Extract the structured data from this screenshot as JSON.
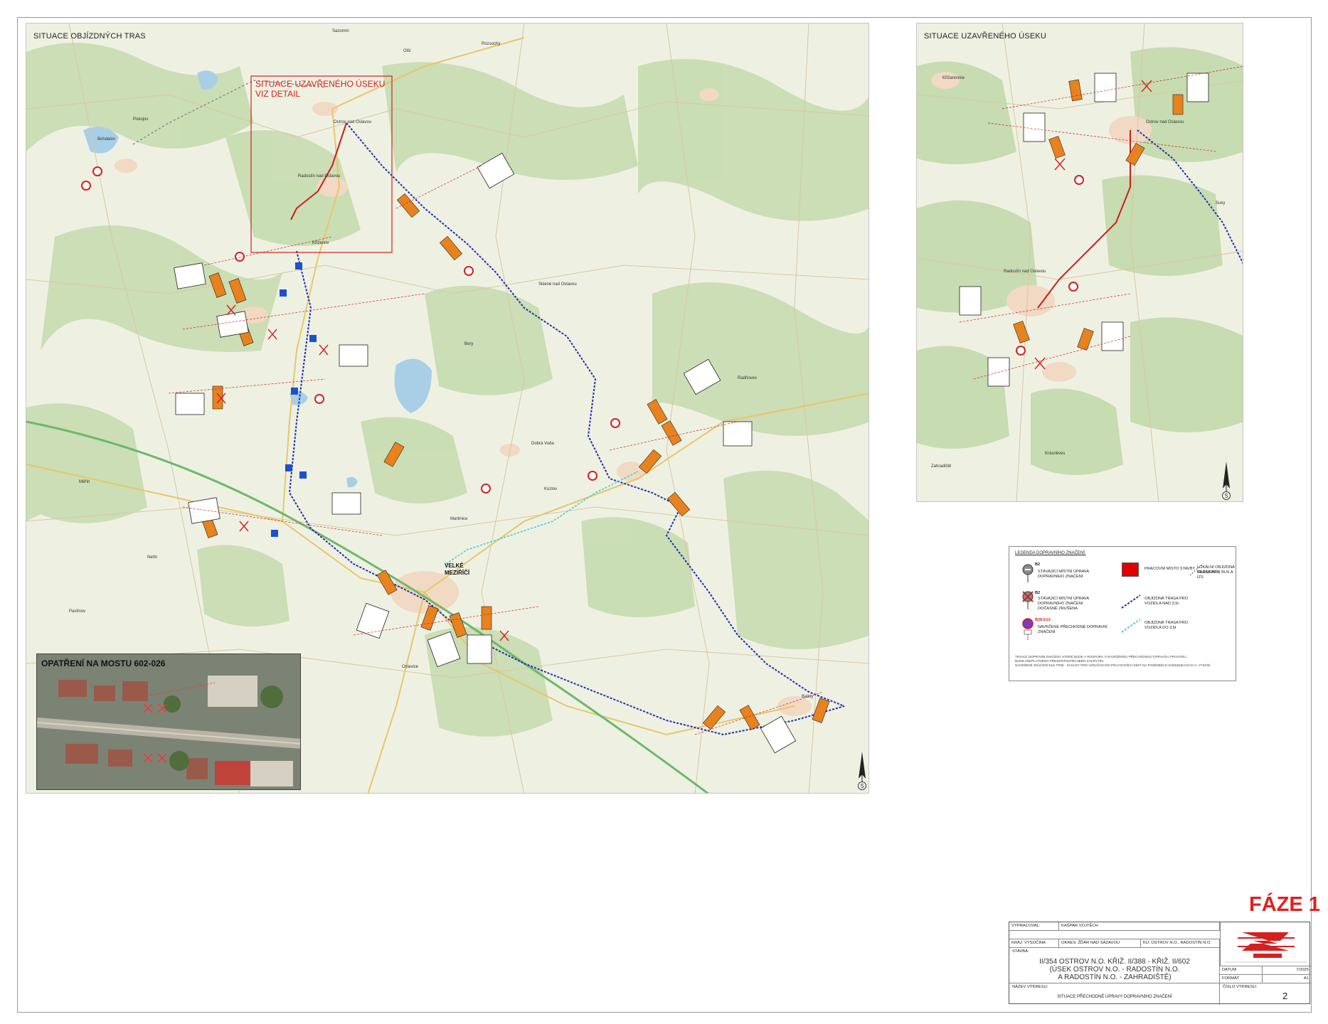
{
  "main_map": {
    "title": "SITUACE OBJÍZDNÝCH TRAS",
    "closed_section_label_line1": "SITUACE UZAVŘENÉHO ÚSEKU",
    "closed_section_label_line2": "VIZ DETAIL",
    "town_label_line1": "VELKÉ",
    "town_label_line2": "MEZIŘÍČÍ",
    "north_label": "S",
    "places": [
      "Bohdalov",
      "Pokojov",
      "Sazomín",
      "Olší",
      "Rozsochy",
      "Ostrov nad Oslavou",
      "Radostín nad Oslavou",
      "Křižanov",
      "Bory",
      "Sklené nad Oslavou",
      "Dobrá Voda",
      "Martinice",
      "Oslavice",
      "Baliny",
      "Měřín",
      "Netín",
      "Pavlínov",
      "Radňoves",
      "Kozlov"
    ]
  },
  "inset": {
    "title": "OPATŘENÍ NA MOSTU 602-026"
  },
  "detail_map": {
    "title": "SITUACE UZAVŘENÉHO ÚSEKU",
    "north_label": "S",
    "places": [
      "Ostrov nad Oslavou",
      "Radostín nad Oslavou",
      "Křižanovice",
      "Zahradiště",
      "Krásněves",
      "Suky"
    ]
  },
  "legend": {
    "title": "LEGENDA DOPRAVNÍHO ZNAČENÍ:",
    "items": [
      {
        "code": "B2",
        "text_line1": "STÁVAJÍCÍ MÍSTNÍ ÚPRAVA",
        "text_line2": "DOPRAVNÍHO ZNAČENÍ",
        "text_line3": ""
      },
      {
        "code": "B2",
        "text_line1": "STÁVAJÍCÍ MÍSTNÍ ÚPRAVA",
        "text_line2": "DOPRAVNÍHO ZNAČENÍ",
        "text_line3": "DOČASNĚ ZRUŠENA"
      },
      {
        "code": "B28 E13",
        "text_line1": "NAVRŽENÉ PŘECHODNÉ DOPRAVNÍ",
        "text_line2": "ZNAČENÍ",
        "text_line3": ""
      }
    ],
    "work_site": "PRACOVNÍ MÍSTO STAVBY",
    "detour_heavy_line1": "OBJÍZDNÁ TRASA PRO",
    "detour_heavy_line2": "VOZIDLA NAD 3,5t",
    "detour_light_line1": "OBJÍZDNÁ TRASA PRO",
    "detour_light_line2": "VOZIDLA DO 3,5t",
    "local_detour_line1": "LOKÁLNÍ OBJÍZDNÁ TRASA PRO",
    "local_detour_line2": "REZIDENTY, BUS A IZS",
    "note1": "TRVALÉ DOPRAVNÍ ZNAČENÍ, KTERÉ BUDE V ROZPORU S NAVRŽENOU PŘECHODNOU ÚPRAVOU PROVOZU,",
    "note2": "BUDE ZNEPLATNĚNO PŘESKRTNUTÍM NEBO ZAKRYTÍM.",
    "note3": "NAVRŽENÉ ZNAČENÍ DLE TP66 - ZÁSADY PRO OZNAČOVÁNÍ PRACOVNÍCH MÍST NA POZEMNÍCH KOMUNIKACÍCH II. VYDÁNÍ"
  },
  "phase": "FÁZE 1",
  "title_block": {
    "vypracoval_label": "VYPRACOVAL:",
    "vypracoval_value": "KAŠPAR VOJTĚCH",
    "kraj": "KRAJ: VYSOČINA",
    "okres": "OKRES: ŽĎÁR NAD SÁZAVOU",
    "ku": "KÚ: OSTROV N.O., RADOSTÍN N.O.",
    "stavba_label": "STAVBA:",
    "stavba_line1": "II/354 OSTROV N.O. KŘIŽ. II/388 - KŘIŽ. II/602",
    "stavba_line2": "(ÚSEK OSTROV N.O. - RADOSTÍN N.O.",
    "stavba_line3": "A RADOSTÍN N.O. - ZAHRADIŠTĚ)",
    "nazev_label": "NÁZEV VÝKRESU:",
    "nazev_value": "SITUACE PŘECHODNÉ ÚPRAVY DOPRAVNÍHO ZNAČENÍ",
    "datum_label": "DATUM",
    "datum_value": "7/2025",
    "format_label": "FORMÁT",
    "format_value": "A1",
    "cislo_label": "ČÍSLO VÝKRESU:",
    "cislo_value": "2"
  }
}
